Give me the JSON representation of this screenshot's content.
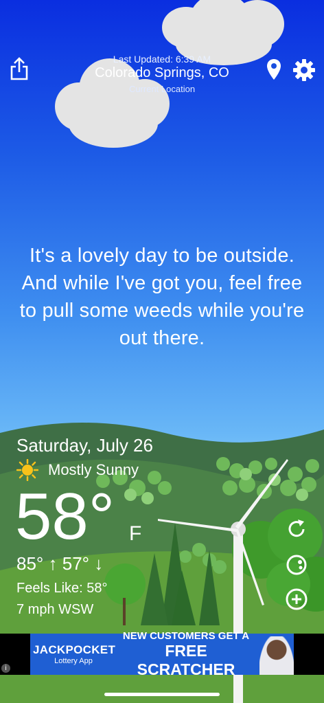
{
  "header": {
    "last_updated": "Last Updated: 6:39 AM",
    "city": "Colorado Springs, CO",
    "location_label": "Current Location"
  },
  "message": "It's a lovely day to be outside. And while I've got you, feel free to pull some weeds while you're out there.",
  "weather": {
    "date": "Saturday, July 26",
    "condition": "Mostly Sunny",
    "temperature": "58°",
    "unit": "F",
    "hi_lo": "85° ↑  57° ↓",
    "feels_like": "Feels Like: 58°",
    "wind": "7 mph WSW"
  },
  "ad": {
    "brand": "JACKPOCKET",
    "brand_sub": "Lottery App",
    "headline_1": "NEW CUSTOMERS GET A",
    "headline_2": "FREE SCRATCHER",
    "info_icon": "i"
  },
  "icons": {
    "share": "share-icon",
    "location": "location-pin-icon",
    "settings": "gear-icon",
    "refresh": "refresh-icon",
    "pacman": "chat-bubble-icon",
    "add": "plus-circle-icon"
  }
}
